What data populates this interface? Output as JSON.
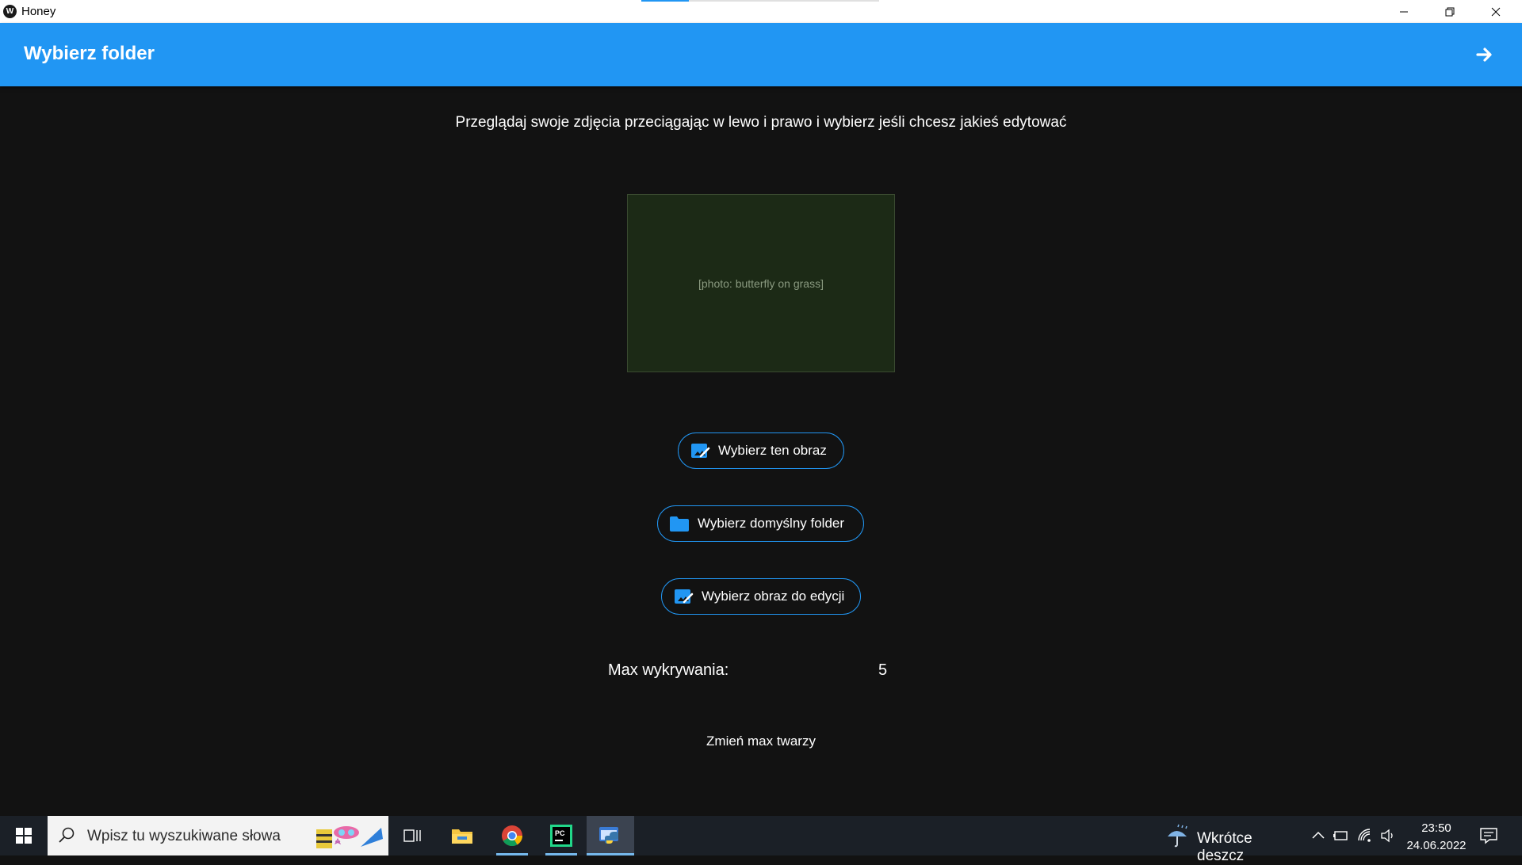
{
  "window": {
    "title": "Honey",
    "app_icon_glyph": "W"
  },
  "appbar": {
    "title": "Wybierz folder",
    "next_icon": "arrow-right-icon"
  },
  "main": {
    "instructions": "Przeglądaj swoje zdjęcia przeciągając w lewo i prawo i wybierz jeśli chcesz jakieś edytować",
    "photo_alt": "[photo: butterfly on grass]",
    "buttons": {
      "select_image": "Wybierz ten obraz",
      "select_default_folder": "Wybierz domyślny folder",
      "select_image_to_edit": "Wybierz obraz do edycji"
    },
    "max_detection_label": "Max wykrywania:",
    "max_detection_value": "5",
    "change_max_faces": "Zmień max twarzy"
  },
  "taskbar": {
    "search_placeholder": "Wpisz tu wyszukiwane słowa",
    "weather": "Wkrótce deszcz",
    "time": "23:50",
    "date": "24.06.2022"
  },
  "colors": {
    "accent": "#2196f3",
    "background": "#121212",
    "taskbar": "#1b2027"
  }
}
